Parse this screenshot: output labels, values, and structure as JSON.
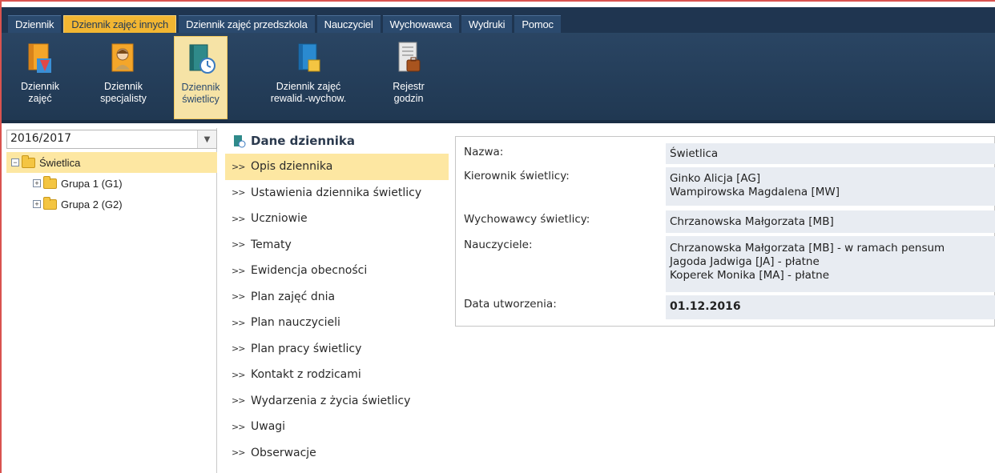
{
  "menu": {
    "tabs": [
      {
        "label": "Dziennik"
      },
      {
        "label": "Dziennik zajęć innych",
        "active": true
      },
      {
        "label": "Dziennik zajęć przedszkola"
      },
      {
        "label": "Nauczyciel"
      },
      {
        "label": "Wychowawca"
      },
      {
        "label": "Wydruki"
      },
      {
        "label": "Pomoc"
      }
    ]
  },
  "ribbon": {
    "buttons": [
      {
        "label": "Dziennik\nzajęć",
        "icon": "class-register-icon"
      },
      {
        "label": "Dziennik\nspecjalisty",
        "icon": "specialist-register-icon"
      },
      {
        "label": "Dziennik\nświetlicy",
        "icon": "daycare-register-icon",
        "active": true
      },
      {
        "label": "Dziennik zajęć\nrewalid.-wychow.",
        "icon": "revalidation-register-icon"
      },
      {
        "label": "Rejestr\ngodzin",
        "icon": "hours-register-icon"
      }
    ]
  },
  "left": {
    "year": "2016/2017",
    "tree": {
      "root": "Świetlica",
      "groups": [
        "Grupa 1 (G1)",
        "Grupa 2 (G2)"
      ]
    }
  },
  "middle": {
    "title": "Dane dziennika",
    "items": [
      {
        "label": "Opis dziennika",
        "active": true
      },
      {
        "label": "Ustawienia dziennika świetlicy"
      },
      {
        "label": "Uczniowie"
      },
      {
        "label": "Tematy"
      },
      {
        "label": "Ewidencja obecności"
      },
      {
        "label": "Plan zajęć dnia"
      },
      {
        "label": "Plan nauczycieli"
      },
      {
        "label": "Plan pracy świetlicy"
      },
      {
        "label": "Kontakt z rodzicami"
      },
      {
        "label": "Wydarzenia z życia świetlicy"
      },
      {
        "label": "Uwagi"
      },
      {
        "label": "Obserwacje"
      }
    ],
    "chevron": ">>"
  },
  "details": {
    "name_label": "Nazwa:",
    "name_value": "Świetlica",
    "manager_label": "Kierownik świetlicy:",
    "manager_values": [
      "Ginko Alicja [AG]",
      "Wampirowska Magdalena [MW]"
    ],
    "educators_label": "Wychowawcy świetlicy:",
    "educators_value": "Chrzanowska Małgorzata [MB]",
    "teachers_label": "Nauczyciele:",
    "teachers_values": [
      "Chrzanowska Małgorzata [MB] - w ramach pensum",
      "Jagoda Jadwiga [JA] - płatne",
      "Koperek Monika [MA] - płatne"
    ],
    "created_label": "Data utworzenia:",
    "created_value": "01.12.2016"
  },
  "colors": {
    "menubar": "#1f3550",
    "accent": "#f2b632",
    "highlight": "#fde7a2",
    "value_bg": "#e8ecf2"
  }
}
